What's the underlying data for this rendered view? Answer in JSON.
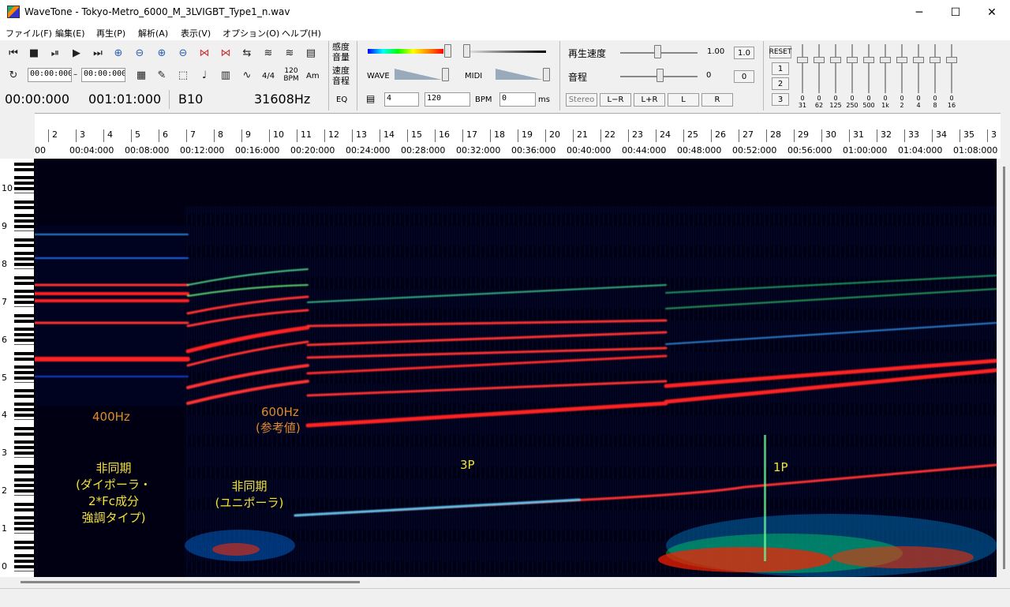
{
  "window": {
    "title": "WaveTone - Tokyo-Metro_6000_M_3LVIGBT_Type1_n.wav",
    "minimize": "─",
    "maximize": "☐",
    "close": "✕"
  },
  "menu": [
    "ファイル(F)",
    "編集(E)",
    "再生(P)",
    "解析(A)",
    "表示(V)",
    "オプション(O)",
    "ヘルプ(H)"
  ],
  "toolbar": {
    "icons_row1": [
      "skip-back-icon",
      "stop-icon",
      "pause-play-icon",
      "play-icon",
      "skip-forward-icon",
      "zoom-in-h-icon",
      "zoom-out-h-icon",
      "zoom-in-v-icon",
      "zoom-out-v-icon",
      "marker-icon",
      "marker-clear-icon",
      "repeat-arrows-icon",
      "wave-icon",
      "wave-alt-icon",
      "book-icon"
    ],
    "sel_start": "00:00:000",
    "dash": "–",
    "sel_end": "00:00:000",
    "icons_row2": [
      "loop-icon",
      "layout-icon",
      "pen-icon",
      "select-rect-icon",
      "note-icon",
      "table-icon",
      "curve-icon"
    ],
    "time_sig": "4/4",
    "bpm_icon_top": "120",
    "bpm_icon_bottom": "BPM",
    "am_label": "Am",
    "position": "00:00:000",
    "measure": "001:01:000",
    "note": "B10",
    "frequency": "31608Hz"
  },
  "display": {
    "sensitivity_label": "感度",
    "volume_label": "音量",
    "speed_label": "速度",
    "pitch_label": "音程",
    "eq_label": "EQ",
    "wave_label": "WAVE",
    "midi_label": "MIDI",
    "beats_value": "4",
    "bpm_value": "120",
    "bpm_label": "BPM",
    "offset_value": "0",
    "ms_label": "ms"
  },
  "playback": {
    "speed_label": "再生速度",
    "speed_value": "1.00",
    "speed_reset": "1.0",
    "pitch_label": "音程",
    "pitch_value": "0",
    "pitch_reset": "0",
    "stereo_buttons": [
      "Stereo",
      "L−R",
      "L+R",
      "L",
      "R"
    ]
  },
  "eq": {
    "reset_label": "RESET",
    "presets": [
      "1",
      "2",
      "3"
    ],
    "bands": [
      "31",
      "62",
      "125",
      "250",
      "500",
      "1k",
      "2",
      "4",
      "8",
      "16"
    ],
    "band_values": [
      "0",
      "0",
      "0",
      "0",
      "0",
      "0",
      "0",
      "0",
      "0",
      "0"
    ]
  },
  "timeline": {
    "measures": [
      "2",
      "3",
      "4",
      "5",
      "6",
      "7",
      "8",
      "9",
      "10",
      "11",
      "12",
      "13",
      "14",
      "15",
      "16",
      "17",
      "18",
      "19",
      "20",
      "21",
      "22",
      "23",
      "24",
      "25",
      "26",
      "27",
      "28",
      "29",
      "30",
      "31",
      "32",
      "33",
      "34",
      "35",
      "3"
    ],
    "times": [
      "00",
      "00:04:000",
      "00:08:000",
      "00:12:000",
      "00:16:000",
      "00:20:000",
      "00:24:000",
      "00:28:000",
      "00:32:000",
      "00:36:000",
      "00:40:000",
      "00:44:000",
      "00:48:000",
      "00:52:000",
      "00:56:000",
      "01:00:000",
      "01:04:000",
      "01:08:000"
    ]
  },
  "piano": {
    "octaves": [
      "10",
      "9",
      "8",
      "7",
      "6",
      "5",
      "4",
      "3",
      "2",
      "1",
      "0"
    ]
  },
  "annotations": {
    "a400": "400Hz",
    "a600_1": "600Hz",
    "a600_2": "(参考値)",
    "async1_1": "非同期",
    "async1_2": "(ダイポーラ・",
    "async1_3": "2*Fc成分",
    "async1_4": "強調タイプ)",
    "async2_1": "非同期",
    "async2_2": "(ユニポーラ)",
    "p3": "3P",
    "p1": "1P"
  },
  "colors": {
    "orange_annotation": "#e08a2c",
    "yellow_annotation": "#f3e23a",
    "spectrogram_bg": "#000010",
    "strong_line": "#ff1a1a"
  }
}
